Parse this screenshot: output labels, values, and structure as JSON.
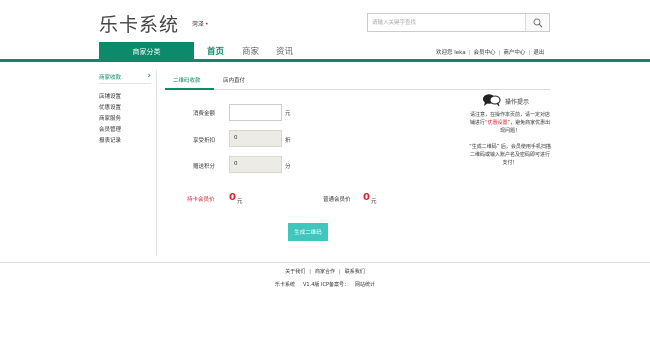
{
  "header": {
    "logo": "乐卡系统",
    "city": "菏泽",
    "city_marker": "•",
    "search_placeholder": "请输入关键字查找"
  },
  "nav": {
    "category_label": "商家分类",
    "items": [
      {
        "label": "首页",
        "active": true
      },
      {
        "label": "商家",
        "active": false
      },
      {
        "label": "资讯",
        "active": false
      }
    ],
    "user_links": {
      "welcome": "欢迎您 leka",
      "member_center": "会员中心",
      "merchant_center": "商户中心",
      "logout": "退出"
    }
  },
  "sidebar": {
    "heading": "商家收款",
    "arrow": "›",
    "items": [
      "店铺设置",
      "优惠设置",
      "商家服务",
      "会员管理",
      "报表记录"
    ]
  },
  "tabs": [
    {
      "label": "二维码收款",
      "active": true
    },
    {
      "label": "店内直付",
      "active": false
    }
  ],
  "form": {
    "amount_label": "消费金额",
    "amount_value": "",
    "amount_unit": "元",
    "discount_label": "享受折扣",
    "discount_value": "0",
    "discount_unit": "折",
    "points_label": "赠送积分",
    "points_value": "0",
    "points_unit": "分",
    "card_price_label": "持卡会员价",
    "card_price_value": "0",
    "card_price_unit": "元",
    "normal_price_label": "普通会员价",
    "normal_price_value": "0",
    "normal_price_unit": "元",
    "generate_button": "生成二维码"
  },
  "tips": {
    "title": "操作提示",
    "p1_before": "请注意，在操作本页前，请一定对店铺进行",
    "p1_highlight": "“优惠设置”",
    "p1_after": "，避免商家优惠出现问题！",
    "p2": "“生成二维码” 后，会员使用手机扫描二维码或输入账户名及密码即可进行支付！"
  },
  "footer": {
    "links": [
      "关于我们",
      "商家合作",
      "联系我们"
    ],
    "separator": "|",
    "brand": "乐卡系统",
    "version": "V1.4版 ICP备案号：",
    "stats": "网站统计"
  },
  "colors": {
    "brand": "#0d8a6a",
    "button": "#3fc6bd",
    "price": "#d9232d"
  }
}
